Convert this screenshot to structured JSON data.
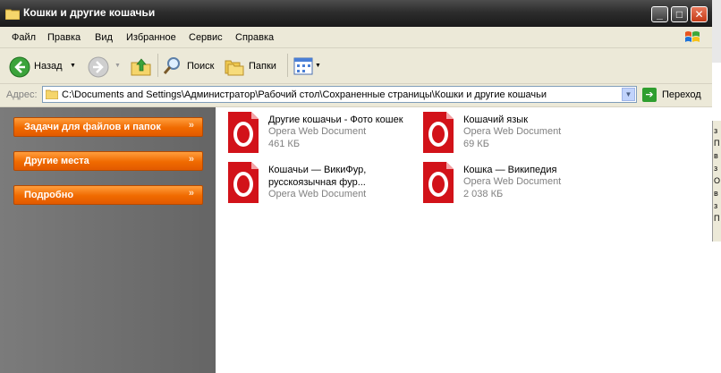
{
  "window": {
    "title": "Кошки и другие кошачьи"
  },
  "menu": [
    "Файл",
    "Правка",
    "Вид",
    "Избранное",
    "Сервис",
    "Справка"
  ],
  "toolbar": {
    "back_label": "Назад",
    "search_label": "Поиск",
    "folders_label": "Папки"
  },
  "address": {
    "label": "Адрес:",
    "path": "C:\\Documents and Settings\\Администратор\\Рабочий стол\\Сохраненные страницы\\Кошки и другие кошачьи",
    "go_label": "Переход"
  },
  "taskpane": {
    "sections": [
      {
        "label": "Задачи для файлов и папок"
      },
      {
        "label": "Другие места"
      },
      {
        "label": "Подробно"
      }
    ]
  },
  "files": [
    {
      "name": "Другие кошачьи - Фото кошек",
      "type": "Opera Web Document",
      "size": "461 КБ"
    },
    {
      "name": "Кошачий язык",
      "type": "Opera Web Document",
      "size": "69 КБ"
    },
    {
      "name": "Кошачьи — ВикиФур, русскоязычная фур...",
      "type": "Opera Web Document",
      "size": ""
    },
    {
      "name": "Кошка — Википедия",
      "type": "Opera Web Document",
      "size": "2 038 КБ"
    }
  ],
  "background_window": {
    "chars": [
      "з",
      "П",
      "в",
      "з",
      "О",
      "в",
      "з",
      "П"
    ]
  },
  "colors": {
    "titlebar": "#2d2d2d",
    "taskpane": "#6e6e6e",
    "task_header": "#f06a00",
    "opera_red": "#cc0f16"
  },
  "icons": {
    "back": "back-arrow-icon",
    "forward": "forward-arrow-icon",
    "up": "folder-up-icon",
    "search": "magnifier-icon",
    "folders": "folders-icon",
    "views": "views-icon",
    "file": "opera-document-icon"
  }
}
